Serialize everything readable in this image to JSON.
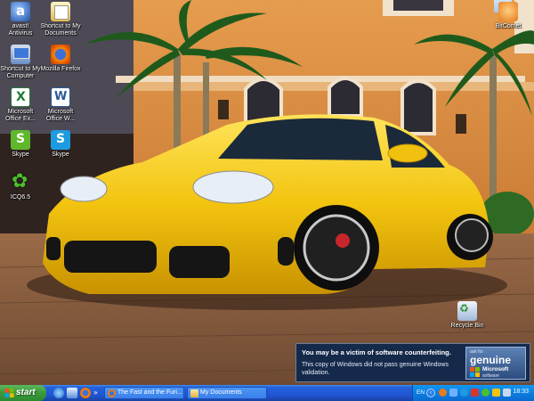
{
  "desktop": {
    "icons_left": [
      {
        "label": "avast! Antivirus",
        "icon": "avast-icon"
      },
      {
        "label": "Shortcut to My Documents",
        "icon": "my-documents-icon"
      },
      {
        "label": "Shortcut to My Computer",
        "icon": "my-computer-icon"
      },
      {
        "label": "Mozilla Firefox",
        "icon": "firefox-icon"
      },
      {
        "label": "Microsoft Office Ex...",
        "icon": "excel-icon"
      },
      {
        "label": "Microsoft Office W...",
        "icon": "word-icon"
      },
      {
        "label": "Skype",
        "icon": "skype-icon"
      },
      {
        "label": "Skype",
        "icon": "skype-icon"
      },
      {
        "label": "ICQ6.5",
        "icon": "icq-icon"
      }
    ],
    "icon_bitcomet": {
      "label": "BitComet",
      "icon": "bitcomet-icon"
    },
    "icon_recycle": {
      "label": "Recycle Bin",
      "icon": "recycle-bin-icon"
    }
  },
  "genuine_notice": {
    "title": "You may be a victim of software counterfeiting.",
    "body": "This copy of Windows did not pass genuine Windows validation.",
    "badge_ask": "ask for",
    "badge_genuine": "genuine",
    "badge_microsoft": "Microsoft",
    "badge_software": "software"
  },
  "taskbar": {
    "start_label": "start",
    "quick_launch": [
      "internet-explorer-icon",
      "show-desktop-icon",
      "firefox-icon"
    ],
    "tasks": [
      {
        "label": "The Fast and the Furi...",
        "icon": "firefox-icon"
      },
      {
        "label": "My Documents",
        "icon": "folder-icon"
      }
    ],
    "tray": {
      "language": "EN",
      "clock": "18:33"
    }
  },
  "colors": {
    "taskbar_blue": "#2157d6",
    "start_green": "#3a9a3a",
    "tray_blue": "#0d7fe0",
    "car_yellow": "#f2c40f",
    "wall_orange": "#d98a3c"
  }
}
